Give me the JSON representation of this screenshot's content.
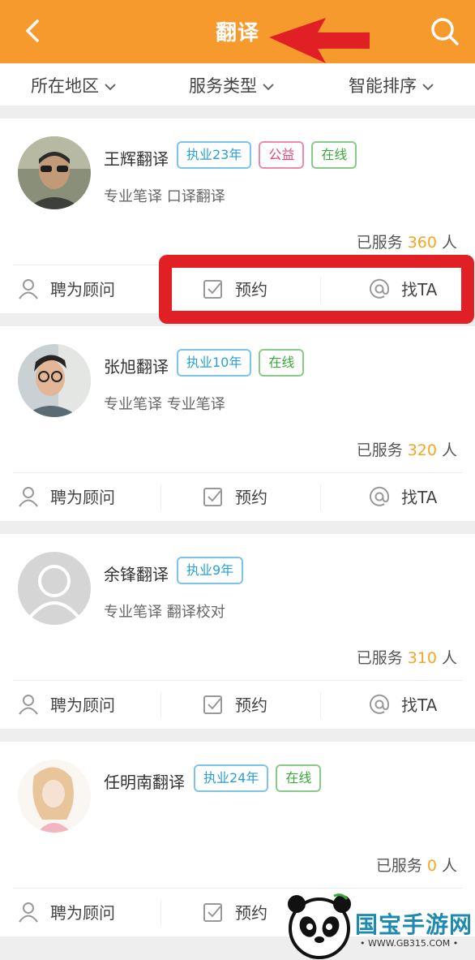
{
  "header": {
    "title": "翻译",
    "back_icon": "chevron-left-icon",
    "search_icon": "search-icon",
    "color": "#f79a2e"
  },
  "filters": [
    {
      "label": "所在地区"
    },
    {
      "label": "服务类型"
    },
    {
      "label": "智能排序"
    }
  ],
  "actions": {
    "hire": "聘为顾问",
    "book": "预约",
    "contact": "找TA"
  },
  "served_prefix": "已服务",
  "served_suffix": "人",
  "translators": [
    {
      "name": "王辉翻译",
      "experience": "执业23年",
      "public_welfare": "公益",
      "online": "在线",
      "services": "专业笔译 口译翻译",
      "served": "360"
    },
    {
      "name": "张旭翻译",
      "experience": "执业10年",
      "online": "在线",
      "services": "专业笔译 专业笔译",
      "served": "320"
    },
    {
      "name": "余锋翻译",
      "experience": "执业9年",
      "services": "专业笔译 翻译校对",
      "served": "310"
    },
    {
      "name": "任明南翻译",
      "experience": "执业24年",
      "online": "在线",
      "services": "",
      "served": "0"
    }
  ],
  "watermark": {
    "brand": "国宝手游网",
    "url": "• WWW.GB315.COM •"
  }
}
